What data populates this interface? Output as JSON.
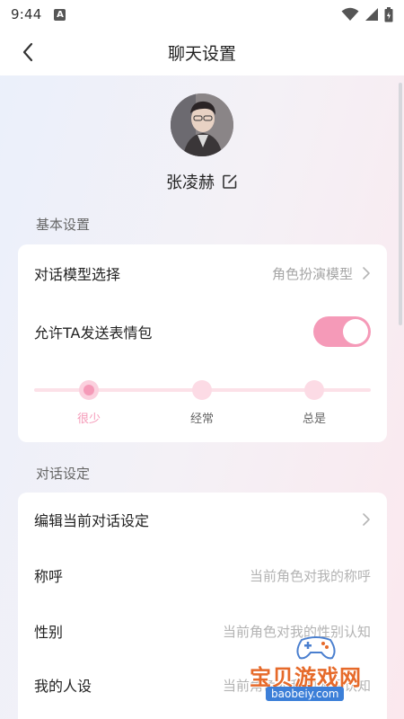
{
  "status_bar": {
    "time": "9:44",
    "notification_letter": "A"
  },
  "header": {
    "title": "聊天设置"
  },
  "profile": {
    "name": "张凌赫"
  },
  "sections": {
    "basic_title": "基本设置",
    "dialog_title": "对话设定"
  },
  "basic": {
    "model_label": "对话模型选择",
    "model_value": "角色扮演模型",
    "emoji_label": "允许TA发送表情包",
    "emoji_enabled": true,
    "frequency_options": [
      "很少",
      "经常",
      "总是"
    ],
    "frequency_selected": "很少"
  },
  "dialog": {
    "edit_label": "编辑当前对话设定",
    "nickname_label": "称呼",
    "nickname_placeholder": "当前角色对我的称呼",
    "gender_label": "性别",
    "gender_placeholder": "当前角色对我的性别认知",
    "persona_label": "我的人设",
    "persona_placeholder": "当前角色对我的人设认知"
  },
  "watermark": {
    "brand": "宝贝游戏网",
    "url": "baobeiy.com"
  },
  "colors": {
    "accent_pink": "#f59ab8",
    "background_blue": "#eaf0fb",
    "background_pink": "#fbe8ee"
  },
  "icons": {
    "back": "chevron-left-icon",
    "edit": "edit-icon",
    "row_arrow": "chevron-right-icon",
    "wifi": "wifi-icon",
    "signal": "signal-icon",
    "battery": "battery-icon"
  }
}
